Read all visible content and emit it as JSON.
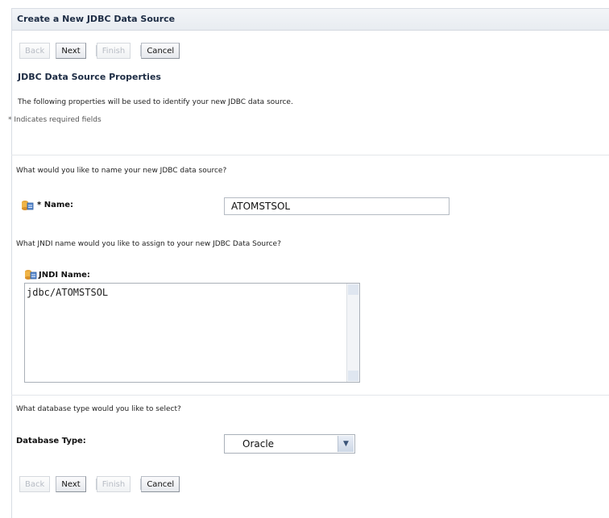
{
  "dialog": {
    "title": "Create a New JDBC Data Source"
  },
  "buttons": {
    "back": "Back",
    "next": "Next",
    "finish": "Finish",
    "cancel": "Cancel"
  },
  "section": {
    "heading": "JDBC Data Source Properties",
    "description": "The following properties will be used to identify your new JDBC data source.",
    "required_note": "* Indicates required fields"
  },
  "name_field": {
    "question": "What would you like to name your new JDBC data source?",
    "label": "* Name:",
    "value": "ATOMSTSOL",
    "icon": "database-icon"
  },
  "jndi_field": {
    "question": "What JNDI name would you like to assign to your new JDBC Data Source?",
    "label": "JNDI Name:",
    "value": "jdbc/ATOMSTSOL",
    "icon": "database-icon"
  },
  "db_type": {
    "question": "What database type would you like to select?",
    "label": "Database Type:",
    "selected": "Oracle"
  },
  "colors": {
    "title_text": "#1d2c44",
    "border": "#b5bbc3"
  }
}
